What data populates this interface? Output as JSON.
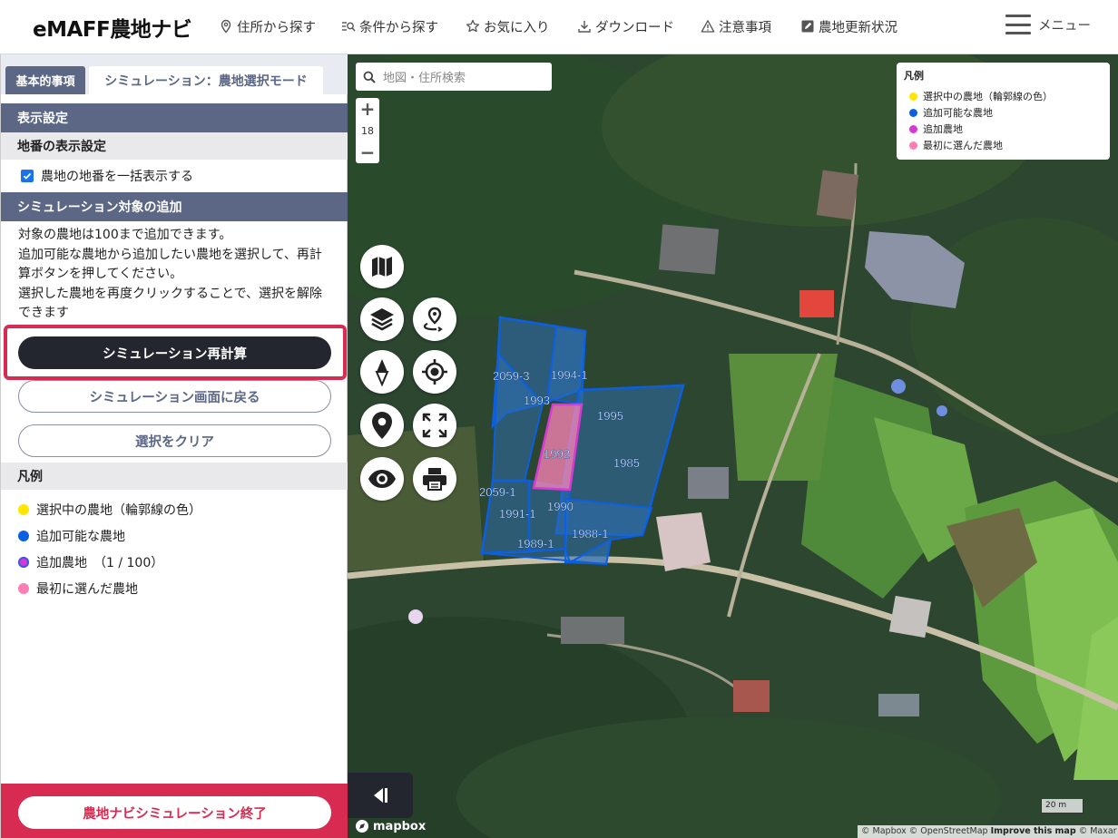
{
  "header": {
    "logo": "eMAFF農地ナビ",
    "nav": [
      {
        "label": "住所から探す",
        "icon": "map-pin-icon"
      },
      {
        "label": "条件から探す",
        "icon": "search-list-icon"
      },
      {
        "label": "お気に入り",
        "icon": "star-icon"
      },
      {
        "label": "ダウンロード",
        "icon": "download-icon"
      },
      {
        "label": "注意事項",
        "icon": "warning-icon"
      },
      {
        "label": "農地更新状況",
        "icon": "edit-icon"
      }
    ],
    "menu_label": "メニュー"
  },
  "panel": {
    "tab_basic": "基本的事項",
    "tab_sim": "シミュレーション：農地選択モード",
    "display_settings": "表示設定",
    "lot_display": "地番の表示設定",
    "show_lot_numbers": "農地の地番を一括表示する",
    "add_target": "シミュレーション対象の追加",
    "desc_lines": [
      "対象の農地は100まで追加できます。",
      "追加可能な農地から追加したい農地を選択して、再計",
      "算ボタンを押してください。",
      "選択した農地を再度クリックすることで、選択を解除",
      "できます"
    ],
    "btn_recalc": "シミュレーション再計算",
    "btn_back": "シミュレーション画面に戻る",
    "btn_clear": "選択をクリア",
    "legend_title": "凡例",
    "legend": [
      {
        "label": "選択中の農地（輪郭線の色）",
        "color": "#ffe600"
      },
      {
        "label": "追加可能な農地",
        "color": "#0b5fe0"
      },
      {
        "label": "追加農地　（1 / 100）",
        "color": "#d63ad3"
      },
      {
        "label": "最初に選んだ農地",
        "color": "#ff7fb4"
      }
    ],
    "btn_end": "農地ナビシミュレーション終了"
  },
  "map": {
    "search_placeholder": "地図・住所検索",
    "zoom_level": "18",
    "zoom_in": "+",
    "zoom_out": "−",
    "legend_title": "凡例",
    "legend": [
      {
        "label": "選択中の農地（輪郭線の色）",
        "color": "#ffe600"
      },
      {
        "label": "追加可能な農地",
        "color": "#0b5fe0"
      },
      {
        "label": "追加農地",
        "color": "#d63ad3"
      },
      {
        "label": "最初に選んだ農地",
        "color": "#ff7fb4"
      }
    ],
    "parcels": [
      "2059-3",
      "1994-1",
      "1993",
      "1995",
      "1992",
      "1985",
      "2059-1",
      "1990",
      "1991-1",
      "1988-1",
      "1989-1"
    ],
    "mapbox": "mapbox",
    "scale": "20 m",
    "attribution": {
      "mapbox": "© Mapbox",
      "osm": "© OpenStreetMap",
      "improve": "Improve this map",
      "maxar": "© Maxar"
    }
  },
  "colors": {
    "accent": "#5c6685",
    "danger": "#d72b52",
    "dark": "#23262f",
    "parcel_blue": "#0b5fe0"
  }
}
